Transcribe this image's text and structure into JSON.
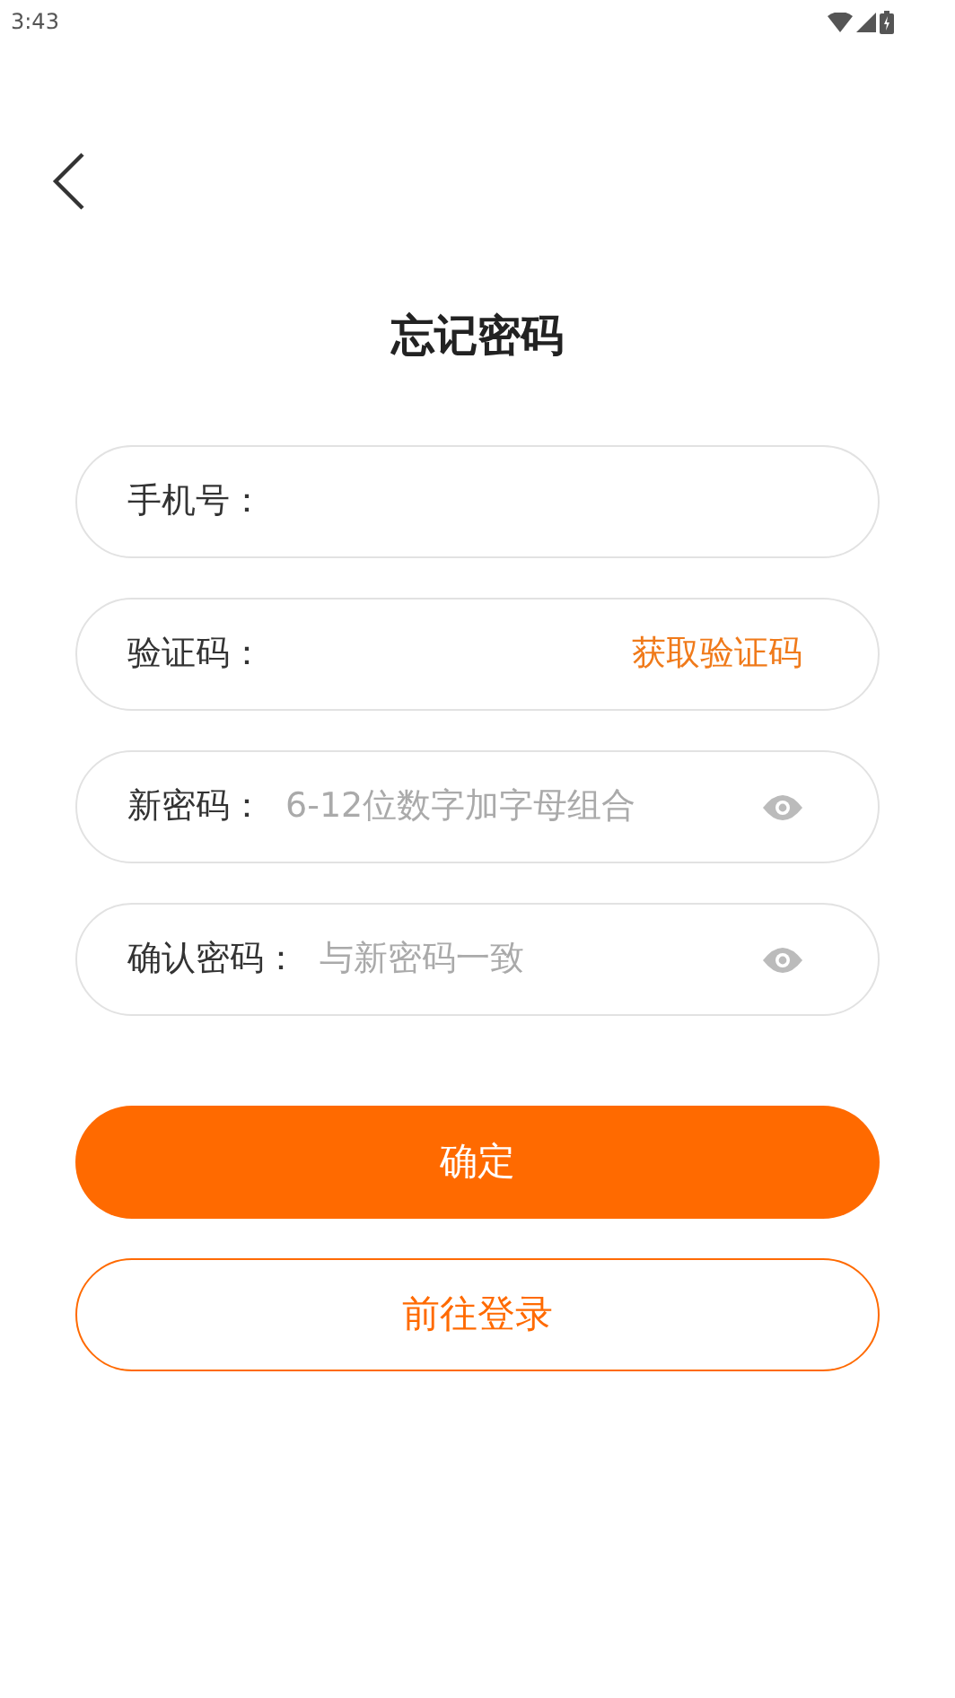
{
  "status_bar": {
    "time": "3:43"
  },
  "title": "忘记密码",
  "fields": [
    {
      "kind": "plain",
      "label": "手机号："
    },
    {
      "kind": "code",
      "label": "验证码：",
      "action": "获取验证码"
    },
    {
      "kind": "password",
      "label": "新密码：",
      "placeholder": "6-12位数字加字母组合"
    },
    {
      "kind": "password",
      "label": "确认密码：",
      "placeholder": "与新密码一致"
    }
  ],
  "buttons": [
    {
      "kind": "primary",
      "label": "确定"
    },
    {
      "kind": "outline",
      "label": "前往登录"
    }
  ]
}
